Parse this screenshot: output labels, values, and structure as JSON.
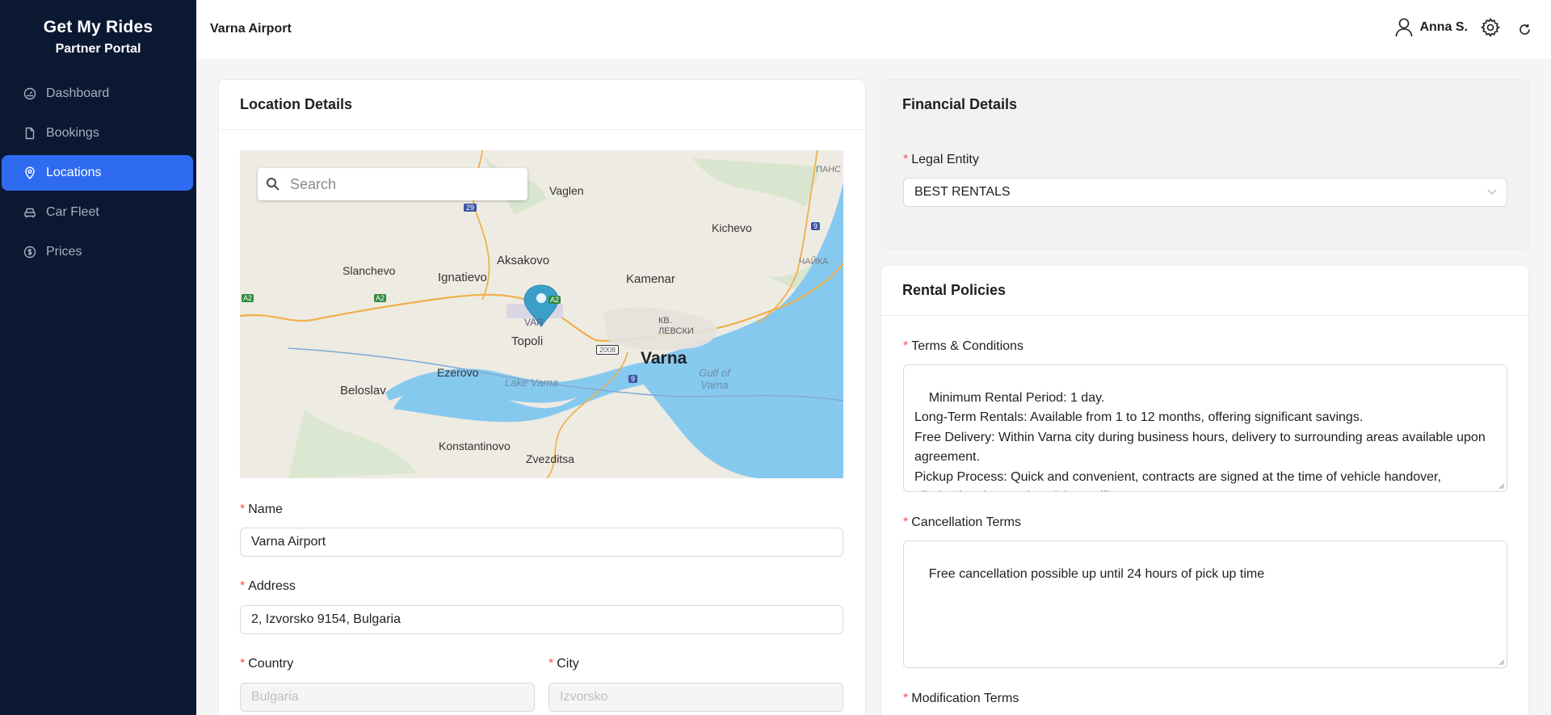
{
  "brand": {
    "title": "Get My Rides",
    "subtitle": "Partner Portal"
  },
  "sidebar": {
    "items": [
      {
        "label": "Dashboard",
        "icon": "dashboard-icon",
        "active": false
      },
      {
        "label": "Bookings",
        "icon": "file-icon",
        "active": false
      },
      {
        "label": "Locations",
        "icon": "map-pin-icon",
        "active": true
      },
      {
        "label": "Car Fleet",
        "icon": "car-icon",
        "active": false
      },
      {
        "label": "Prices",
        "icon": "dollar-circle-icon",
        "active": false
      }
    ]
  },
  "header": {
    "title": "Varna Airport",
    "user_name": "Anna S."
  },
  "location": {
    "card_title": "Location Details",
    "map": {
      "search_placeholder": "Search",
      "labels": {
        "vaglen": "Vaglen",
        "kichevo": "Kichevo",
        "slanchevo": "Slanchevo",
        "ignatievo": "Ignatievo",
        "aksakovo": "Aksakovo",
        "kamenar": "Kamenar",
        "var": "VAR",
        "topoli": "Topoli",
        "varna": "Varna",
        "ezerovo": "Ezerovo",
        "beloslav": "Beloslav",
        "lake": "Lake Varna",
        "gulf": "Gulf of Varna",
        "konstantinovo": "Konstantinovo",
        "zvezditsa": "Zvezditsa",
        "levski": "КВ. ЛЕВСКИ",
        "chayka": "ЧАЙКА",
        "pancho": "ПАНС",
        "r29": "29",
        "r9a": "9",
        "r9b": "9",
        "r2008": "2008",
        "a2a": "A2",
        "a2b": "A2",
        "a2c": "A2"
      }
    },
    "fields": {
      "name_label": "Name",
      "name_value": "Varna Airport",
      "address_label": "Address",
      "address_value": "2, Izvorsko 9154, Bulgaria",
      "country_label": "Country",
      "country_value": "Bulgaria",
      "city_label": "City",
      "city_value": "Izvorsko"
    }
  },
  "financial": {
    "card_title": "Financial Details",
    "legal_entity_label": "Legal Entity",
    "legal_entity_value": "BEST RENTALS"
  },
  "policies": {
    "card_title": "Rental Policies",
    "terms_label": "Terms & Conditions",
    "terms_value": "Minimum Rental Period: 1 day.\nLong-Term Rentals: Available from 1 to 12 months, offering significant savings.\nFree Delivery: Within Varna city during business hours, delivery to surrounding areas available upon agreement.\nPickup Process: Quick and convenient, contracts are signed at the time of vehicle handover, eliminating the need to visit an office.",
    "cancellation_label": "Cancellation Terms",
    "cancellation_value": "Free cancellation possible up until 24 hours of pick up time",
    "modification_label": "Modification Terms"
  }
}
